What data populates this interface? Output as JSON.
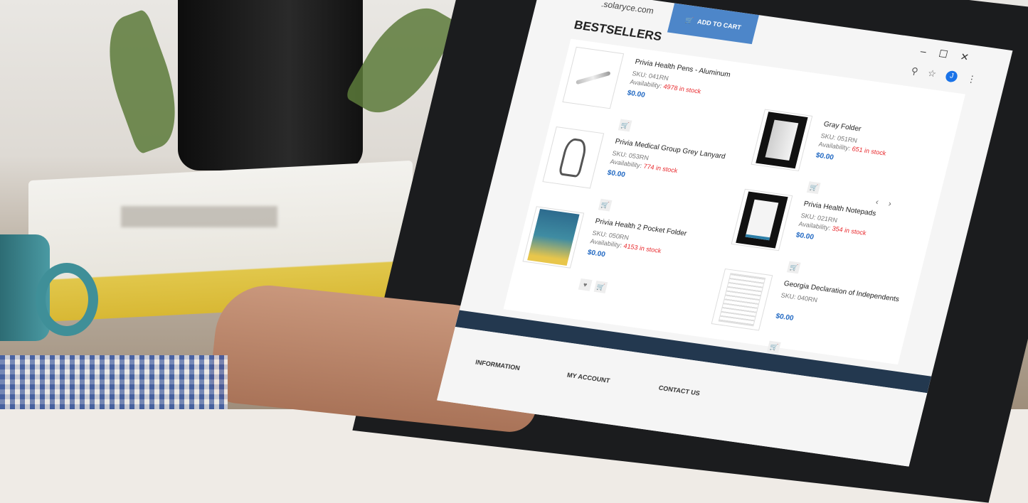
{
  "browser": {
    "url": ".solaryce.com",
    "window_controls": [
      "–",
      "☐",
      "✕"
    ],
    "avatar_letter": "J"
  },
  "header": {
    "add_to_cart_label": "ADD TO CART",
    "section_title": "BESTSELLERS"
  },
  "carousel": {
    "prev": "‹",
    "next": "›"
  },
  "products_left": [
    {
      "name": "Privia Health Pens - Aluminum",
      "sku": "SKU: 041RN",
      "availability_label": "Availability:",
      "stock": "4978 in stock",
      "price": "$0.00"
    },
    {
      "name": "Privia Medical Group Grey Lanyard",
      "sku": "SKU: 053RN",
      "availability_label": "Availability:",
      "stock": "774 in stock",
      "price": "$0.00"
    },
    {
      "name": "Privia Health 2 Pocket Folder",
      "sku": "SKU: 050RN",
      "availability_label": "Availability:",
      "stock": "4153 in stock",
      "price": "$0.00"
    }
  ],
  "products_right": [
    {
      "name": "Gray Folder",
      "sku": "SKU: 051RN",
      "availability_label": "Availability:",
      "stock": "651 in stock",
      "price": "$0.00"
    },
    {
      "name": "Privia Health Notepads",
      "sku": "SKU: 021RN",
      "availability_label": "Availability:",
      "stock": "354 in stock",
      "price": "$0.00"
    },
    {
      "name": "Georgia Declaration of Independents",
      "sku": "SKU: 040RN",
      "availability_label": "",
      "stock": "",
      "price": "$0.00"
    }
  ],
  "footer": {
    "information": "INFORMATION",
    "my_account": "MY ACCOUNT",
    "contact_us": "CONTACT US"
  },
  "icons": {
    "cart": "cart-icon",
    "wishlist": "heart-icon",
    "search": "search-icon",
    "star": "star-icon",
    "menu": "menu-icon"
  }
}
